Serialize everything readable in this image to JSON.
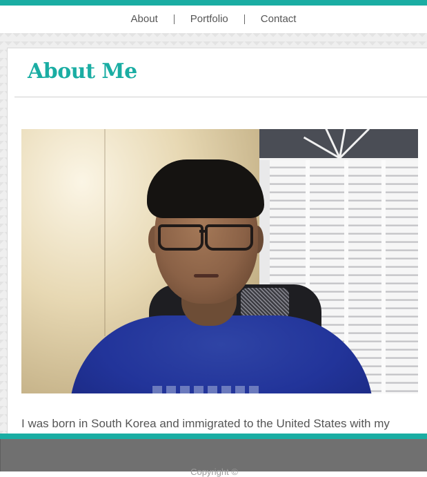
{
  "nav": {
    "items": [
      {
        "label": "About"
      },
      {
        "label": "Portfolio"
      },
      {
        "label": "Contact"
      }
    ]
  },
  "main": {
    "title": "About Me",
    "bio": "I was born in South Korea and immigrated to the United States with my"
  },
  "footer": {
    "copyright": "Copyright ©"
  },
  "colors": {
    "accent": "#1aada3",
    "footer_bg": "#707070",
    "body_text": "#555555"
  }
}
